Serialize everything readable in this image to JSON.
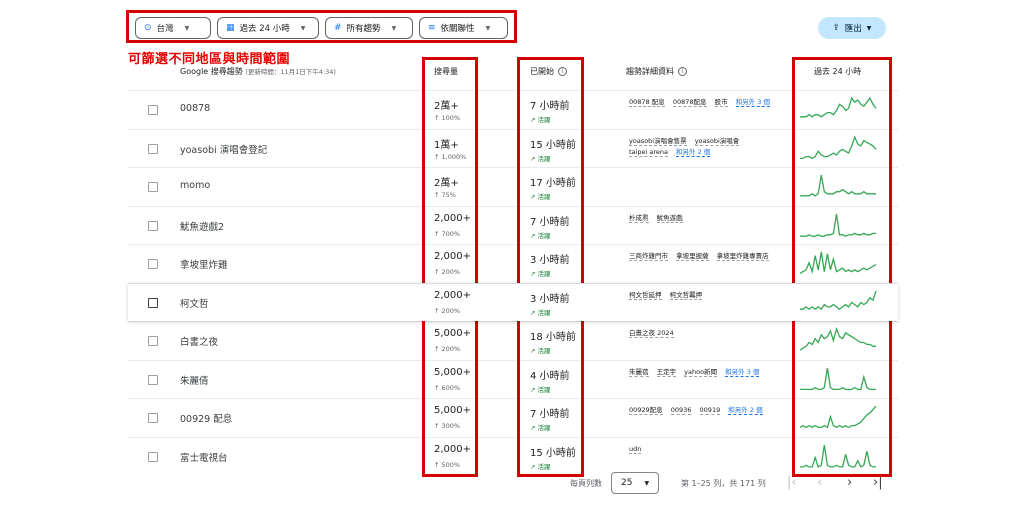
{
  "filters": {
    "region": "台灣",
    "time": "過去 24 小時",
    "category": "所有趨勢",
    "sort": "依關聯性"
  },
  "export_label": "匯出",
  "annotation": "可篩選不同地區與時間範圍",
  "header": {
    "title": "Google 搜尋趨勢",
    "updated": "(更新時間：11月1日下午4:34)",
    "volume": "搜尋量",
    "started": "已開始",
    "breakdown": "趨勢詳細資料",
    "past24": "過去 24 小時"
  },
  "rows": [
    {
      "keyword": "00878",
      "volume": "2萬+",
      "pct": "↑ 100%",
      "started": "7 小時前",
      "active": "活躍",
      "tags": [
        "00878 配息",
        "00878配息",
        "股市"
      ],
      "more": "和另外 3 個",
      "spark": [
        3,
        3,
        3,
        4,
        3,
        4,
        4,
        3,
        4,
        5,
        5,
        4,
        6,
        9,
        8,
        6,
        7,
        12,
        10,
        11,
        9,
        8,
        10,
        12,
        9,
        7
      ]
    },
    {
      "keyword": "yoasobi 演唱會登記",
      "volume": "1萬+",
      "pct": "↑ 1,000%",
      "started": "15 小時前",
      "active": "活躍",
      "tags": [
        "yoasobi演唱會售票",
        "yoasobi演唱會",
        "taipei arena"
      ],
      "more": "和另外 2 個",
      "spark": [
        2,
        2,
        3,
        3,
        2,
        3,
        6,
        4,
        3,
        3,
        4,
        5,
        4,
        6,
        7,
        6,
        5,
        9,
        14,
        10,
        9,
        12,
        11,
        10,
        9,
        7
      ]
    },
    {
      "keyword": "momo",
      "volume": "2萬+",
      "pct": "↑ 75%",
      "started": "17 小時前",
      "active": "活躍",
      "tags": [],
      "more": "",
      "spark": [
        2,
        2,
        2,
        2,
        3,
        2,
        3,
        12,
        4,
        3,
        3,
        3,
        4,
        4,
        5,
        4,
        3,
        4,
        3,
        3,
        3,
        4,
        3,
        3,
        3,
        3
      ]
    },
    {
      "keyword": "魷魚遊戲2",
      "volume": "2,000+",
      "pct": "↑ 700%",
      "started": "7 小時前",
      "active": "活躍",
      "tags": [
        "朴成焄",
        "魷魚遊戲"
      ],
      "more": "",
      "spark": [
        2,
        2,
        2,
        3,
        2,
        2,
        3,
        2,
        2,
        3,
        3,
        4,
        18,
        3,
        3,
        2,
        3,
        3,
        4,
        3,
        3,
        4,
        3,
        3,
        4,
        4
      ]
    },
    {
      "keyword": "拿坡里炸雞",
      "volume": "2,000+",
      "pct": "↑ 200%",
      "started": "3 小時前",
      "active": "活躍",
      "tags": [
        "三商炸雞門市",
        "拿坡里披薩",
        "拿坡里炸雞專賣店"
      ],
      "more": "",
      "spark": [
        2,
        3,
        4,
        8,
        3,
        12,
        4,
        14,
        3,
        13,
        4,
        10,
        3,
        4,
        5,
        3,
        4,
        3,
        4,
        3,
        4,
        5,
        4,
        5,
        6,
        7
      ]
    },
    {
      "keyword": "柯文哲",
      "volume": "2,000+",
      "pct": "↑ 200%",
      "started": "3 小時前",
      "active": "活躍",
      "tags": [
        "柯文哲延押",
        "柯文哲羈押"
      ],
      "more": "",
      "spark": [
        3,
        3,
        4,
        3,
        4,
        3,
        4,
        3,
        5,
        4,
        4,
        5,
        4,
        3,
        4,
        5,
        4,
        6,
        5,
        4,
        6,
        5,
        6,
        8,
        7,
        11
      ]
    },
    {
      "keyword": "白書之夜",
      "volume": "5,000+",
      "pct": "↑ 200%",
      "started": "18 小時前",
      "active": "活躍",
      "tags": [
        "白晝之夜 2024"
      ],
      "more": "",
      "spark": [
        2,
        3,
        4,
        6,
        5,
        8,
        6,
        10,
        8,
        9,
        12,
        7,
        13,
        9,
        8,
        11,
        10,
        9,
        8,
        7,
        6,
        6,
        5,
        5,
        4,
        4
      ]
    },
    {
      "keyword": "朱麗倩",
      "volume": "5,000+",
      "pct": "↑ 600%",
      "started": "4 小時前",
      "active": "活躍",
      "tags": [
        "朱麗蓓",
        "王定宇",
        "yahoo新聞"
      ],
      "more": "和另外 3 個",
      "spark": [
        2,
        2,
        2,
        2,
        2,
        3,
        2,
        2,
        3,
        14,
        3,
        2,
        2,
        2,
        3,
        2,
        2,
        2,
        3,
        2,
        2,
        9,
        3,
        2,
        2,
        2
      ]
    },
    {
      "keyword": "00929 配息",
      "volume": "5,000+",
      "pct": "↑ 300%",
      "started": "7 小時前",
      "active": "活躍",
      "tags": [
        "00929配息",
        "00936",
        "00919"
      ],
      "more": "和另外 2 個",
      "spark": [
        2,
        3,
        2,
        3,
        2,
        3,
        2,
        2,
        3,
        2,
        8,
        3,
        2,
        3,
        2,
        3,
        2,
        3,
        3,
        4,
        5,
        7,
        9,
        10,
        12,
        14
      ]
    },
    {
      "keyword": "富士電視台",
      "volume": "2,000+",
      "pct": "↑ 500%",
      "started": "15 小時前",
      "active": "活躍",
      "tags": [
        "udn"
      ],
      "more": "",
      "spark": [
        2,
        2,
        3,
        2,
        2,
        8,
        2,
        3,
        16,
        3,
        2,
        2,
        3,
        2,
        2,
        10,
        3,
        2,
        2,
        6,
        2,
        3,
        12,
        3,
        2,
        2
      ]
    }
  ],
  "footer": {
    "rows_per_page_label": "每頁列數",
    "rows_per_page": "25",
    "range": "第 1–25 列，共 171 列"
  },
  "colors": {
    "accent": "#1a73e8",
    "active": "#188038",
    "spark": "#34a853",
    "annotation": "#d50000",
    "export_bg": "#c2e7ff"
  }
}
